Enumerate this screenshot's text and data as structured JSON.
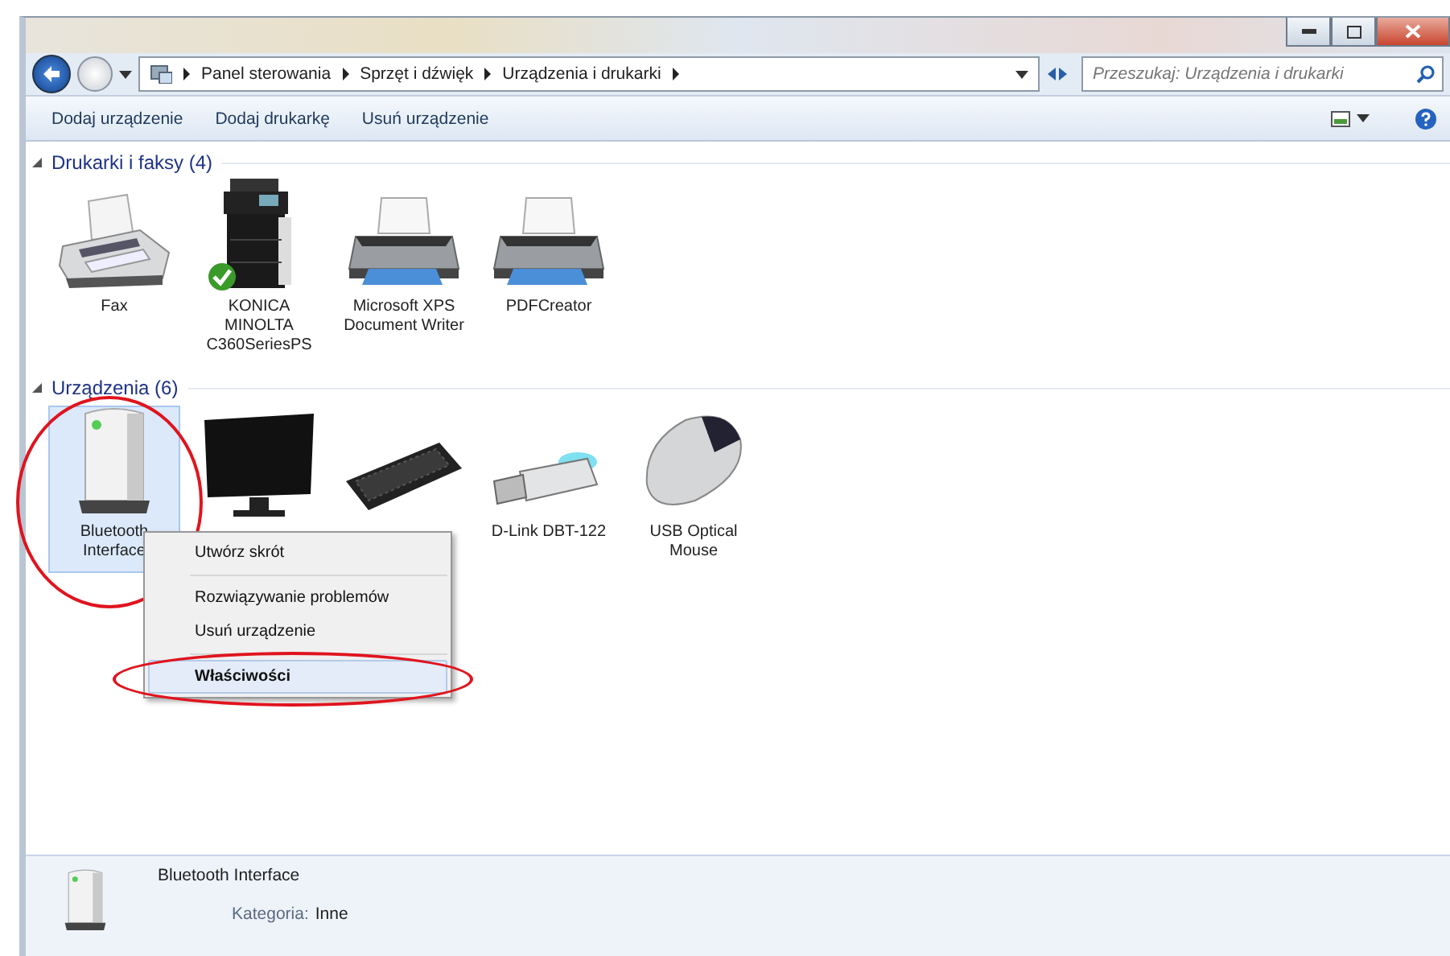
{
  "address_bar": {
    "breadcrumbs": [
      "Panel sterowania",
      "Sprzęt i dźwięk",
      "Urządzenia i drukarki"
    ]
  },
  "search": {
    "placeholder": "Przeszukaj: Urządzenia i drukarki"
  },
  "command_bar": {
    "buttons": [
      "Dodaj urządzenie",
      "Dodaj drukarkę",
      "Usuń urządzenie"
    ]
  },
  "groups": [
    {
      "title": "Drukarki i faksy (4)",
      "expanded": true,
      "items": [
        {
          "kind": "fax",
          "label": "Fax",
          "selected": false,
          "default": false,
          "circled": false
        },
        {
          "kind": "mfp",
          "label": "KONICA MINOLTA C360SeriesPS",
          "selected": false,
          "default": true,
          "circled": false
        },
        {
          "kind": "printer",
          "label": "Microsoft XPS Document Writer",
          "selected": false,
          "default": false,
          "circled": false
        },
        {
          "kind": "printer",
          "label": "PDFCreator",
          "selected": false,
          "default": false,
          "circled": false
        }
      ]
    },
    {
      "title": "Urządzenia (6)",
      "expanded": true,
      "items": [
        {
          "kind": "storage",
          "label": "Bluetooth Interface",
          "selected": true,
          "default": false,
          "circled": true
        },
        {
          "kind": "monitor",
          "selected": false,
          "default": false,
          "circled": false
        },
        {
          "kind": "keyboard",
          "selected": false,
          "default": false,
          "circled": false
        },
        {
          "kind": "usb",
          "label": "D-Link DBT-122",
          "selected": false,
          "default": false,
          "circled": false
        },
        {
          "kind": "mouse",
          "label": "USB Optical Mouse",
          "selected": false,
          "default": false,
          "circled": false
        }
      ]
    }
  ],
  "context_menu": {
    "items": [
      {
        "kind": "item",
        "label": "Utwórz skrót",
        "selected": false,
        "bold": false,
        "circled": false
      },
      {
        "kind": "separator"
      },
      {
        "kind": "item",
        "label": "Rozwiązywanie problemów",
        "selected": false,
        "bold": false,
        "circled": false
      },
      {
        "kind": "item",
        "label": "Usuń urządzenie",
        "selected": false,
        "bold": false,
        "circled": false
      },
      {
        "kind": "separator"
      },
      {
        "kind": "item",
        "label": "Właściwości",
        "selected": true,
        "bold": true,
        "circled": true
      }
    ]
  },
  "details": {
    "name": "Bluetooth Interface",
    "kind": "storage",
    "category_label": "Kategoria:",
    "category_value": "Inne"
  }
}
